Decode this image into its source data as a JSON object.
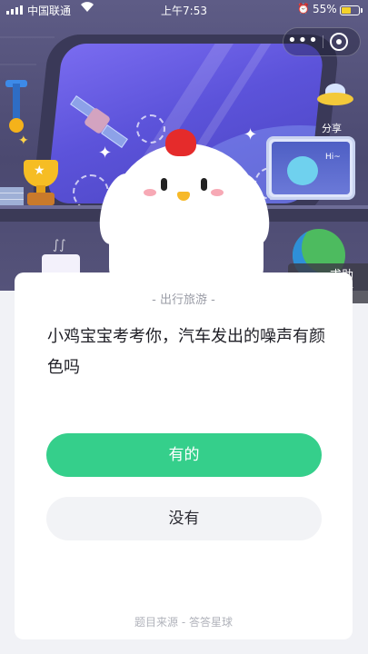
{
  "status_bar": {
    "carrier": "中国联通",
    "time": "上午7:53",
    "battery_percent": "55%",
    "battery_level": 0.55,
    "icons": [
      "signal-icon",
      "wifi-icon",
      "alarm-icon",
      "battery-icon"
    ]
  },
  "capsule": {
    "more_icon": "more-dots-icon",
    "close_icon": "close-circle-icon"
  },
  "scene": {
    "share_label": "分享",
    "monitor_text": "Hi~"
  },
  "help": {
    "label": "求助反馈",
    "icon": "edit-note-icon"
  },
  "card": {
    "category": "- 出行旅游 -",
    "question": "小鸡宝宝考考你，汽车发出的噪声有颜色吗",
    "answers": [
      {
        "label": "有的",
        "color": "#35cf8b"
      },
      {
        "label": "没有",
        "color": "#f2f3f6"
      }
    ],
    "source": "题目来源 - 答答星球"
  }
}
